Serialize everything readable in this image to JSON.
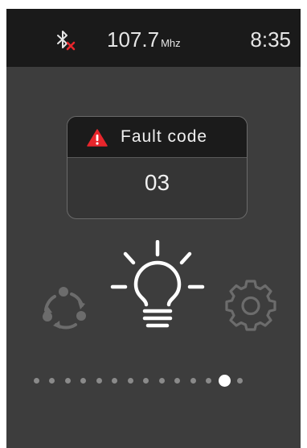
{
  "status_bar": {
    "bluetooth_icon": "bluetooth-disconnected-icon",
    "radio_frequency": "107.7",
    "radio_unit": "Mhz",
    "clock": "8:35"
  },
  "fault": {
    "icon": "warning-icon",
    "title": "Fault code",
    "code": "03"
  },
  "menu": {
    "items": [
      {
        "icon": "refresh-cycle-icon",
        "selected": false
      },
      {
        "icon": "light-bulb-icon",
        "selected": true
      },
      {
        "icon": "settings-gear-icon",
        "selected": false
      }
    ]
  },
  "pager": {
    "total": 14,
    "active_index": 12
  },
  "colors": {
    "screen_bg": "#3d3d3d",
    "status_bar_bg": "#1a1a1a",
    "warning_red": "#e8262c",
    "bluetooth_x_red": "#e8262c",
    "active_icon": "#ffffff",
    "inactive_icon": "#6c6c6c"
  }
}
